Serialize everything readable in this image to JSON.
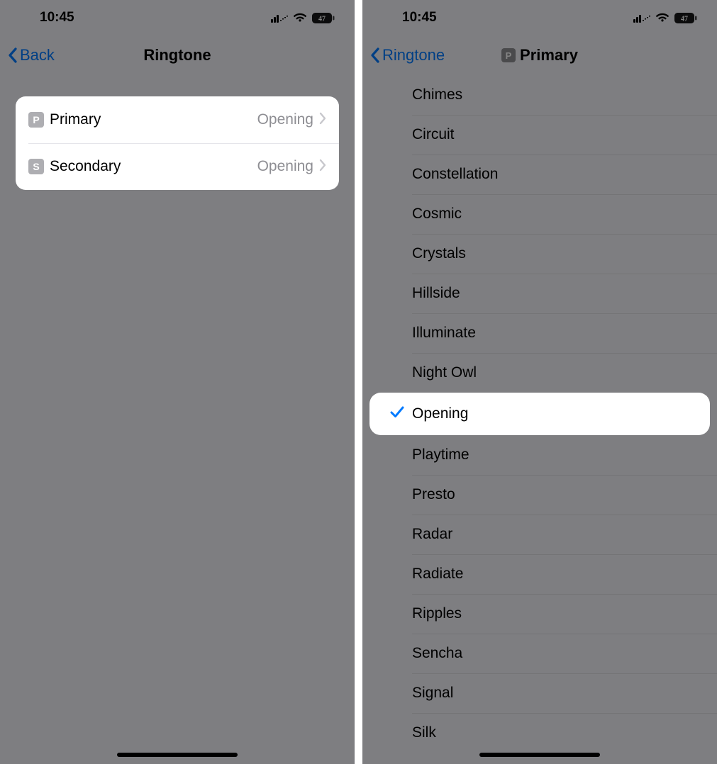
{
  "status": {
    "time": "10:45",
    "battery": "47"
  },
  "phone1": {
    "back_label": "Back",
    "title": "Ringtone",
    "rows": [
      {
        "badge": "P",
        "label": "Primary",
        "value": "Opening"
      },
      {
        "badge": "S",
        "label": "Secondary",
        "value": "Opening"
      }
    ]
  },
  "phone2": {
    "back_label": "Ringtone",
    "title_badge": "P",
    "title": "Primary",
    "selected": "Opening",
    "ringtones": [
      "Chimes",
      "Circuit",
      "Constellation",
      "Cosmic",
      "Crystals",
      "Hillside",
      "Illuminate",
      "Night Owl",
      "Opening",
      "Playtime",
      "Presto",
      "Radar",
      "Radiate",
      "Ripples",
      "Sencha",
      "Signal",
      "Silk"
    ]
  }
}
